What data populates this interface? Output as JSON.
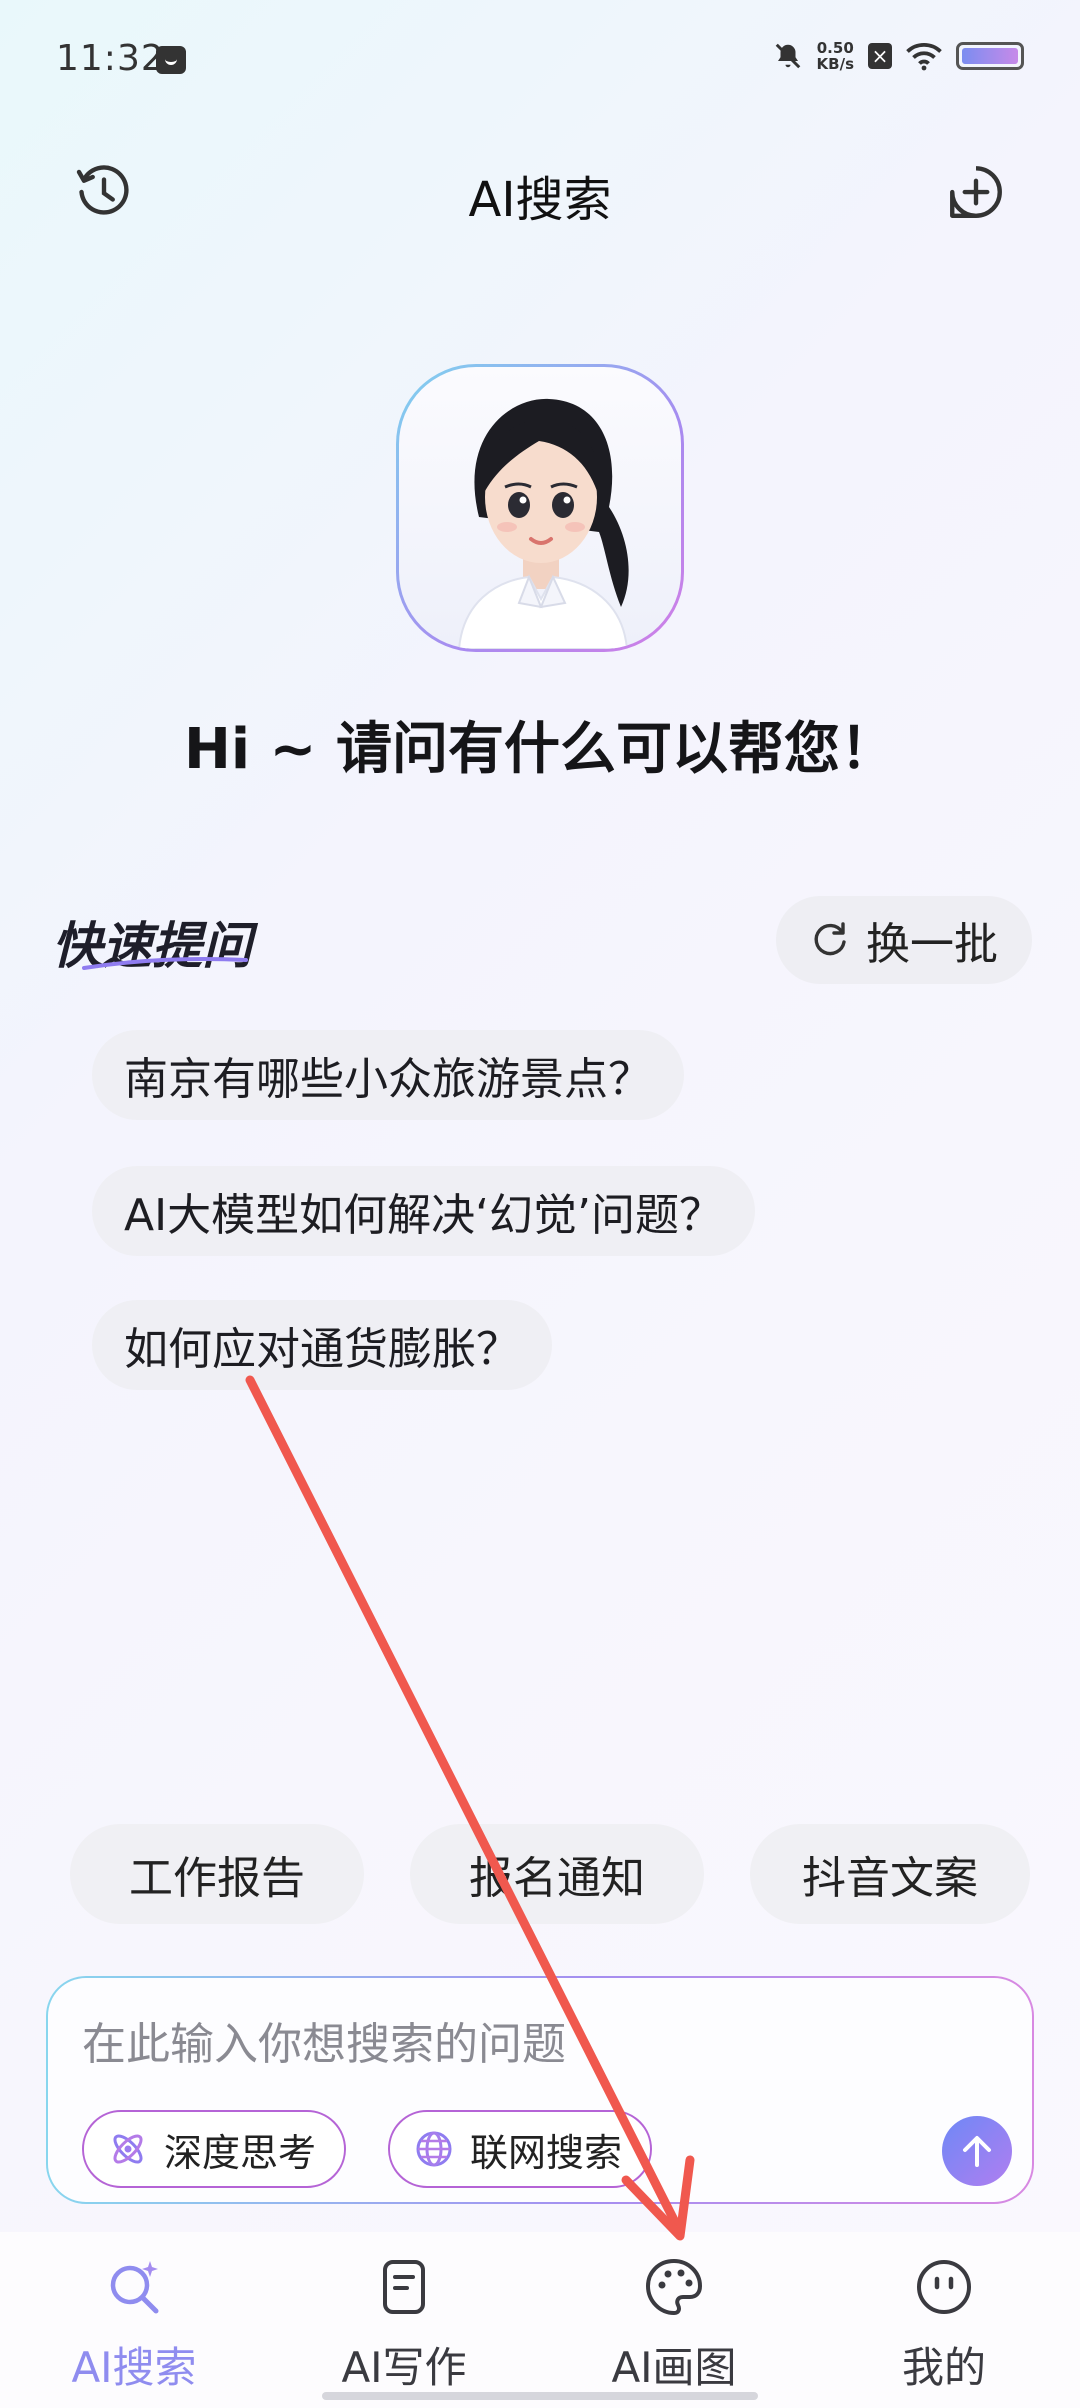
{
  "status_bar": {
    "time": "11:32",
    "net_speed_value": "0.50",
    "net_speed_unit": "KB/s",
    "battery_color": "#a78bf0"
  },
  "header": {
    "title": "AI搜索",
    "history_icon": "history-clock-icon",
    "new_chat_icon": "plus-circle-icon"
  },
  "greeting": "Hi ~ 请问有什么可以帮您！",
  "quick_questions": {
    "title": "快速提问",
    "refresh_label": "换一批",
    "items": [
      "南京有哪些小众旅游景点？",
      "AI大模型如何解决‘幻觉’问题？",
      "如何应对通货膨胀？"
    ]
  },
  "shortcuts": [
    "工作报告",
    "报名通知",
    "抖音文案"
  ],
  "input": {
    "placeholder": "在此输入你想搜索的问题",
    "deep_think_label": "深度思考",
    "web_search_label": "联网搜索"
  },
  "tabs": [
    {
      "label": "AI搜索",
      "icon": "sparkle-search-icon",
      "active": true
    },
    {
      "label": "AI写作",
      "icon": "document-icon",
      "active": false
    },
    {
      "label": "AI画图",
      "icon": "palette-icon",
      "active": false
    },
    {
      "label": "我的",
      "icon": "smiley-face-icon",
      "active": false
    }
  ],
  "colors": {
    "accent": "#8f8cef",
    "annotation_arrow": "#f0584e"
  }
}
